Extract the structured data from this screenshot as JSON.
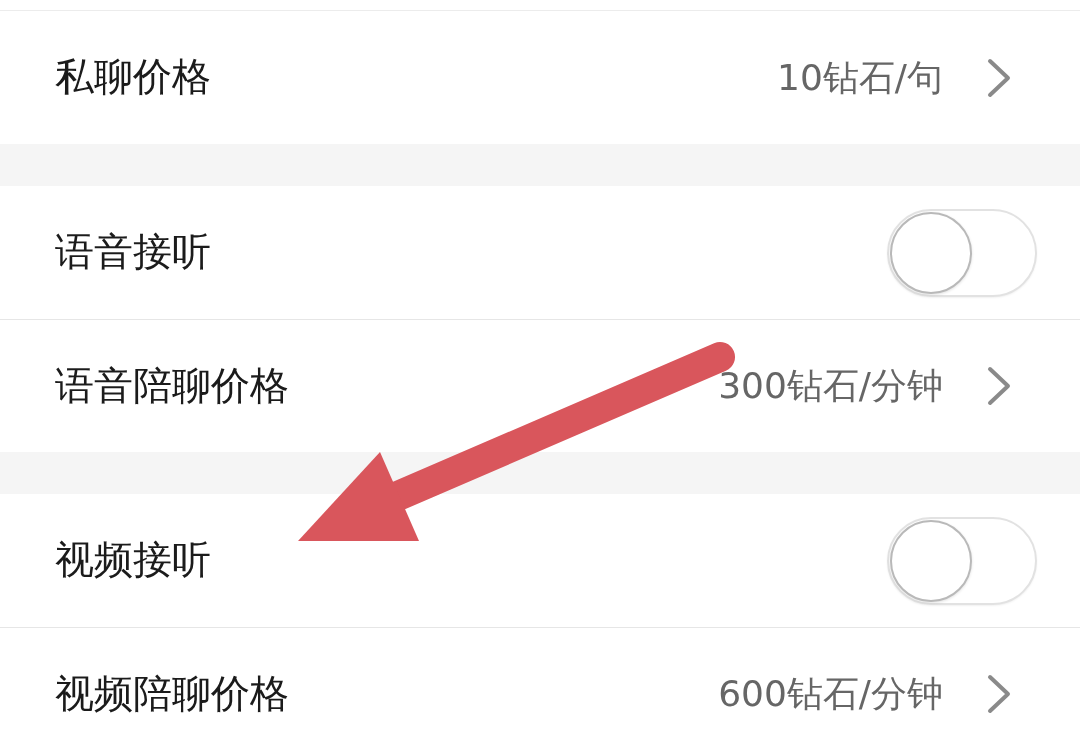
{
  "sections": [
    {
      "rows": [
        {
          "kind": "link",
          "label": "私聊价格",
          "value": "10钻石/句"
        }
      ]
    },
    {
      "rows": [
        {
          "kind": "toggle",
          "label": "语音接听",
          "on": false
        },
        {
          "kind": "link",
          "label": "语音陪聊价格",
          "value": "300钻石/分钟"
        }
      ]
    },
    {
      "rows": [
        {
          "kind": "toggle",
          "label": "视频接听",
          "on": false
        },
        {
          "kind": "link",
          "label": "视频陪聊价格",
          "value": "600钻石/分钟"
        }
      ]
    }
  ]
}
